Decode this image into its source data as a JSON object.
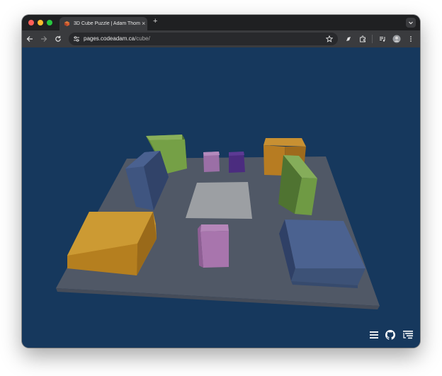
{
  "browser": {
    "tab_title": "3D Cube Puzzle | Adam Thom",
    "tab_close": "×",
    "new_tab": "+",
    "url_host": "pages.codeadam.ca",
    "url_path": "/cube/"
  },
  "icons": {
    "back": "arrow-left-icon",
    "forward": "arrow-right-icon",
    "reload": "reload-icon",
    "bookmark": "star-icon",
    "menu": "hamburger-menu-icon",
    "github": "github-icon",
    "levels": "level-list-icon"
  },
  "scene": {
    "background_color": "#16385d",
    "board_color": "#505866",
    "target_color": "#9c9fa3",
    "blocks": [
      {
        "id": "green-back-left",
        "color": "#75a046"
      },
      {
        "id": "blue-left",
        "color": "#3f5580"
      },
      {
        "id": "pink-back",
        "color": "#9b6fa6"
      },
      {
        "id": "purple-back",
        "color": "#4b2c7f"
      },
      {
        "id": "orange-back-right",
        "color": "#b77c22"
      },
      {
        "id": "green-right",
        "color": "#6f9a44"
      },
      {
        "id": "orange-front-left",
        "color": "#c18a22"
      },
      {
        "id": "pink-center",
        "color": "#a875ad"
      },
      {
        "id": "blue-front-right",
        "color": "#425880"
      }
    ]
  }
}
